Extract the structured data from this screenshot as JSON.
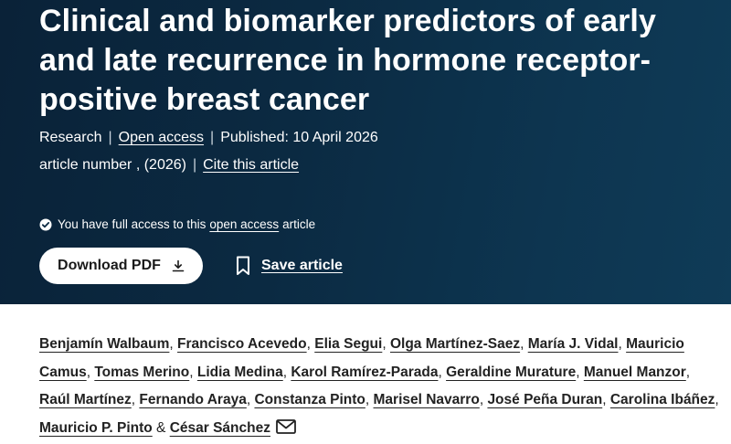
{
  "article": {
    "title": "Clinical and biomarker predictors of early and late recurrence in hormone receptor-positive breast cancer",
    "type": "Research",
    "access_link": "Open access",
    "published": "Published: 10 April 2026",
    "article_number": "article number , (2026)",
    "cite_link": "Cite this article"
  },
  "access_notice": {
    "prefix": "You have full access to this",
    "link": "open access",
    "suffix": "article",
    "icon": "check-circle-icon"
  },
  "actions": {
    "download_label": "Download PDF",
    "download_icon": "download-icon",
    "save_label": "Save article",
    "save_icon": "bookmark-icon"
  },
  "authors": [
    {
      "name": "Benjamín Walbaum",
      "sep": ", "
    },
    {
      "name": "Francisco Acevedo",
      "sep": ", "
    },
    {
      "name": "Elia Segui",
      "sep": ", "
    },
    {
      "name": "Olga Martínez-Saez",
      "sep": ", "
    },
    {
      "name": "María J. Vidal",
      "sep": ", "
    },
    {
      "name": "Mauricio Camus",
      "sep": ", "
    },
    {
      "name": "Tomas Merino",
      "sep": ", "
    },
    {
      "name": "Lidia Medina",
      "sep": ", "
    },
    {
      "name": "Karol Ramírez-Parada",
      "sep": ", "
    },
    {
      "name": "Geraldine Murature",
      "sep": ", "
    },
    {
      "name": "Manuel Manzor",
      "sep": ", "
    },
    {
      "name": "Raúl Martínez",
      "sep": ", "
    },
    {
      "name": "Fernando Araya",
      "sep": ", "
    },
    {
      "name": "Constanza Pinto",
      "sep": ", "
    },
    {
      "name": "Marisel Navarro",
      "sep": ", "
    },
    {
      "name": "José Peña Duran",
      "sep": ", "
    },
    {
      "name": "Carolina Ibáñez",
      "sep": ", "
    },
    {
      "name": "Mauricio P. Pinto",
      "sep": " & "
    },
    {
      "name": "César Sánchez",
      "sep": ""
    }
  ],
  "colors": {
    "hero_bg": "#0b2a42",
    "text_dark": "#222222"
  }
}
